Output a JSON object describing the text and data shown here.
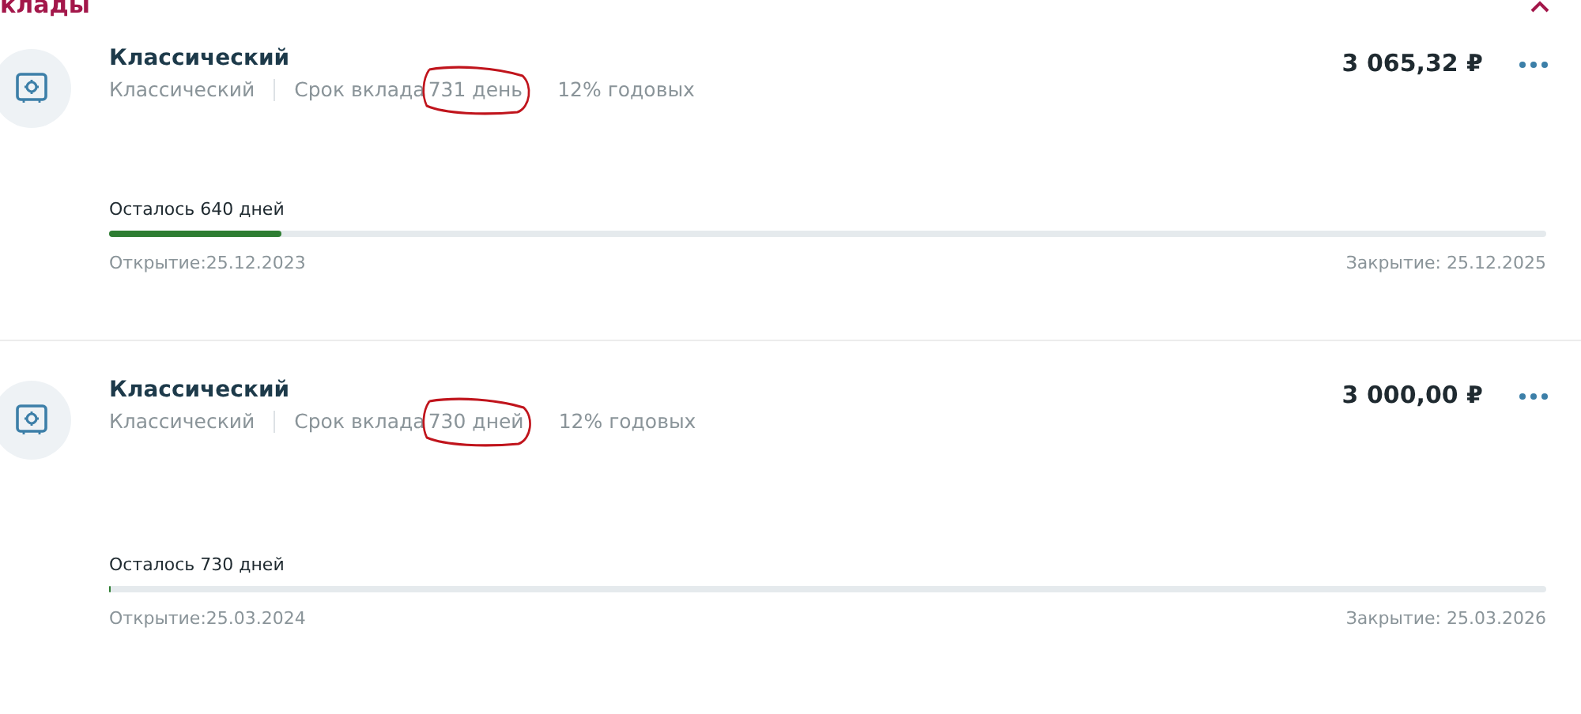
{
  "section": {
    "title": "клады",
    "expanded": true
  },
  "deposits": [
    {
      "name": "Классический",
      "product": "Классический",
      "term_label": "Срок вклада",
      "term": "731 день",
      "term_circled": true,
      "rate": "12% годовых",
      "amount": "3 065,32 ₽",
      "remaining": "Осталось 640 дней",
      "level": 0.12,
      "opened": "Открытие:25.12.2023",
      "closes": "Закрытие: 25.12.2025"
    },
    {
      "name": "Классический",
      "product": "Классический",
      "term_label": "Срок вклада",
      "term": "730 дней",
      "term_circled": true,
      "rate": "12% годовых",
      "amount": "3 000,00 ₽",
      "remaining": "Осталось 730 дней",
      "level": 0,
      "opened": "Открытие:25.03.2024",
      "closes": "Закрытие: 25.03.2026"
    }
  ]
}
